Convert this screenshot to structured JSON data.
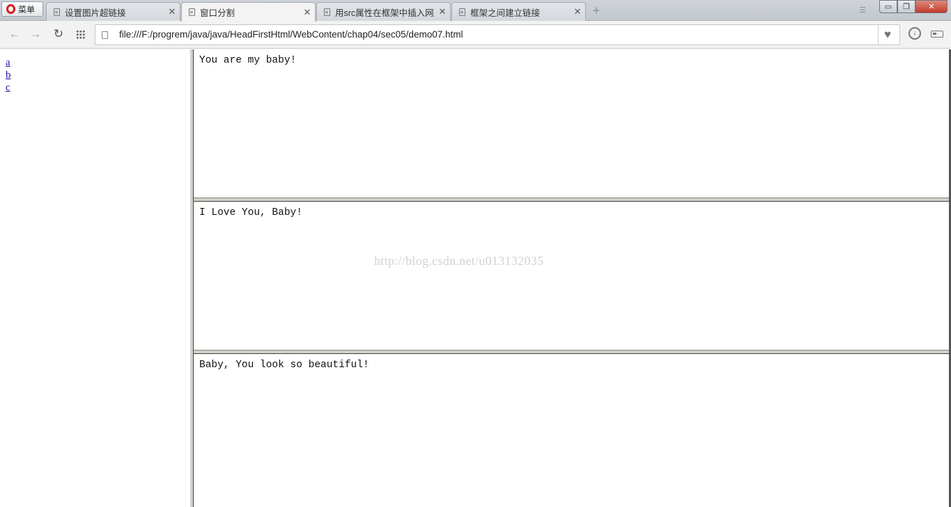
{
  "browser": {
    "menu_label": "菜单",
    "tabs": [
      {
        "title": "设置图片超链接",
        "active": false
      },
      {
        "title": "窗口分割",
        "active": true
      },
      {
        "title": "用src属性在框架中插入网页",
        "active": false
      },
      {
        "title": "框架之间建立链接",
        "active": false
      }
    ],
    "close_glyph": "✕",
    "new_tab_glyph": "+",
    "url": "file:///F:/progrem/java/java/HeadFirstHtml/WebContent/chap04/sec05/demo07.html",
    "window_controls": {
      "minimize": "▭",
      "maximize": "❐",
      "close": "✕"
    }
  },
  "left_frame": {
    "links": [
      "a",
      "b",
      "c"
    ]
  },
  "right_frames": [
    {
      "text": "You are my baby!"
    },
    {
      "text": "I Love You, Baby!"
    },
    {
      "text": "Baby, You look so beautiful!"
    }
  ],
  "watermark": "http://blog.csdn.net/u013132035",
  "colors": {
    "link": "#1a0dab",
    "opera_red": "#d71a21",
    "frame_border": "#d4d0c8"
  }
}
